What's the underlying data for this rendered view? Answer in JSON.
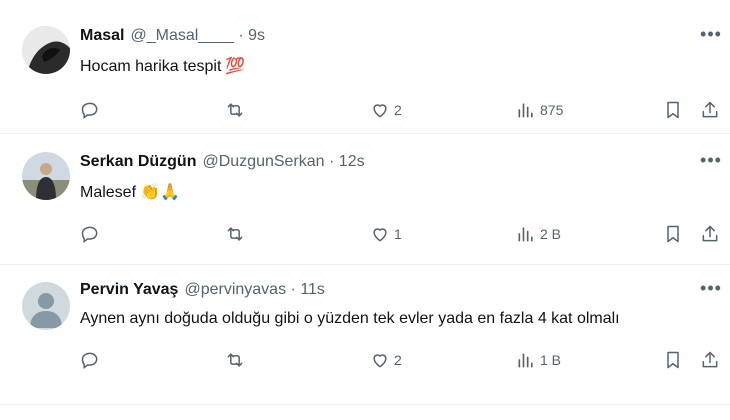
{
  "tweets": [
    {
      "name": "Masal",
      "handle": "@_Masal____",
      "separator": "·",
      "time": "9s",
      "text": "Hocam harika tespit",
      "emoji": "💯",
      "likes": "2",
      "views": "875"
    },
    {
      "name": "Serkan Düzgün",
      "handle": "@DuzgunSerkan",
      "separator": "·",
      "time": "12s",
      "text": "Malesef",
      "emoji": "👏🙏",
      "likes": "1",
      "views": "2 B"
    },
    {
      "name": "Pervin Yavaş",
      "handle": "@pervinyavas",
      "separator": "·",
      "time": "11s",
      "text": "Aynen aynı doğuda olduğu gibi o yüzden tek evler yada en fazla 4 kat olmalı",
      "emoji": "",
      "likes": "2",
      "views": "1 B"
    }
  ],
  "more_glyph": "•••",
  "colors": {
    "text": "#0f1419",
    "secondary": "#536471",
    "divider": "#eff3f4"
  }
}
